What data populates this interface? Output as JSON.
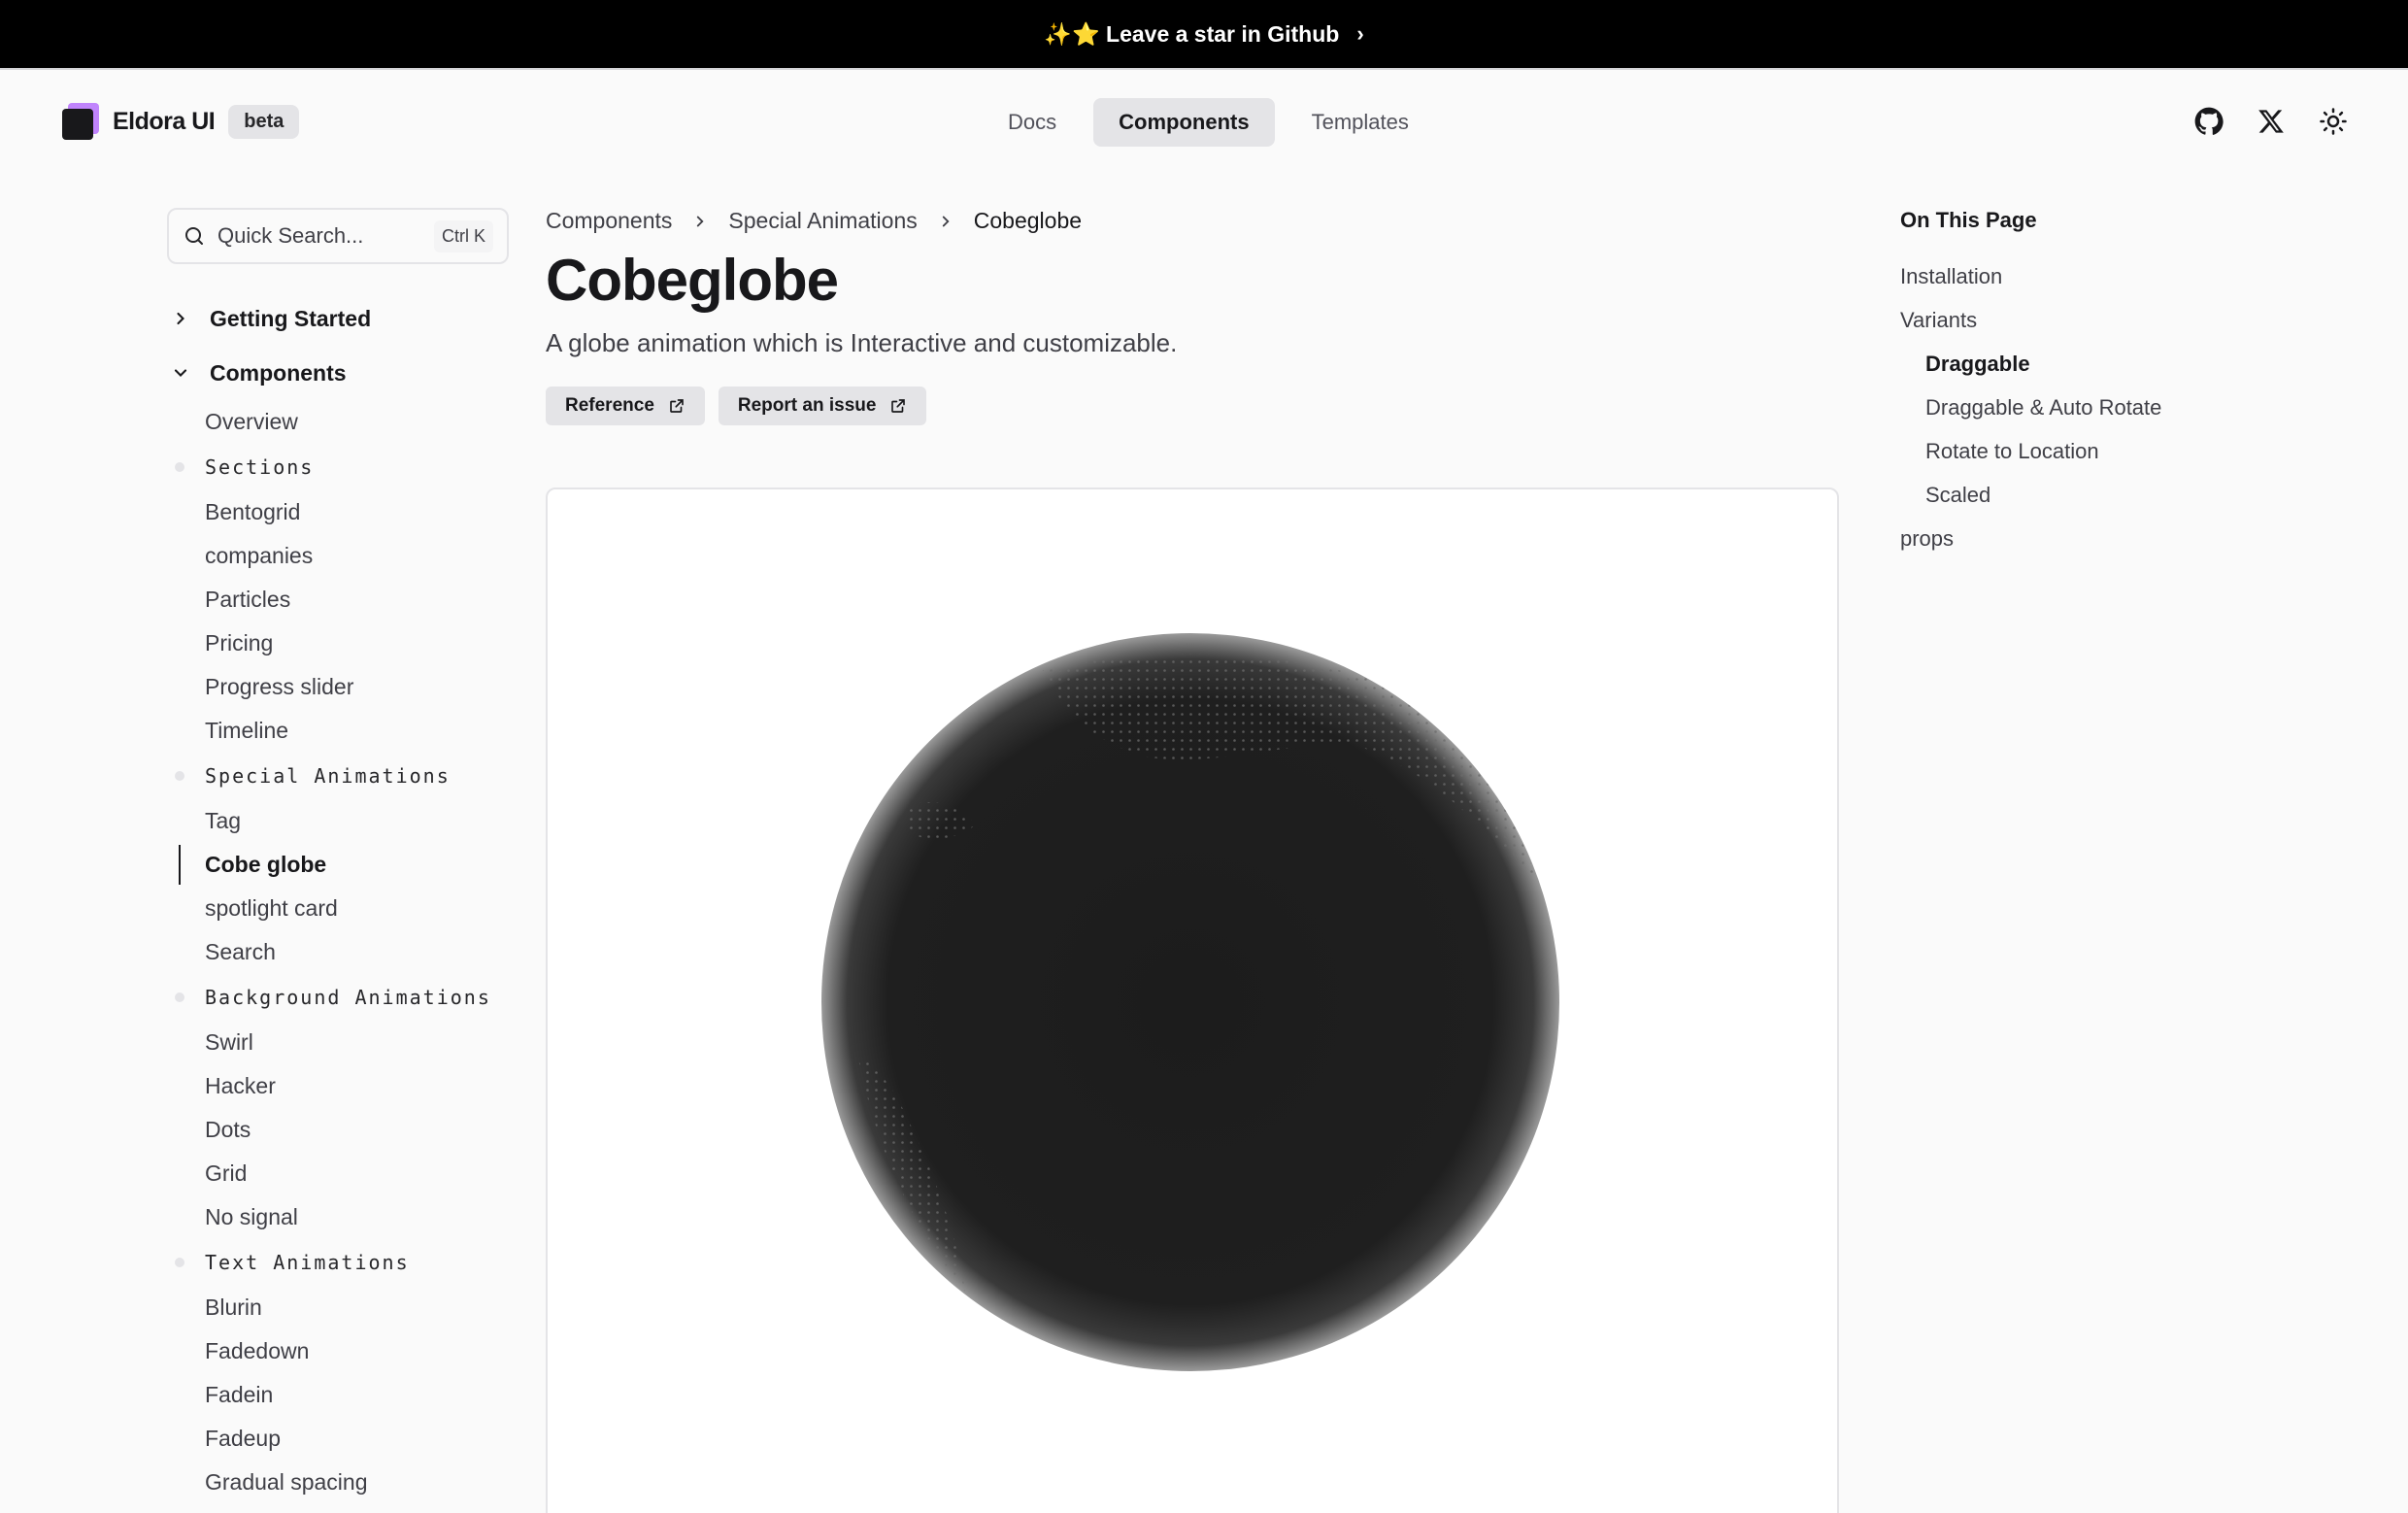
{
  "banner": {
    "text": "✨⭐ Leave a star in Github",
    "chevron": "›"
  },
  "header": {
    "brand": "Eldora UI",
    "badge": "beta",
    "nav": [
      {
        "label": "Docs",
        "active": false
      },
      {
        "label": "Components",
        "active": true
      },
      {
        "label": "Templates",
        "active": false
      }
    ],
    "icons": [
      "github-icon",
      "x-icon",
      "sun-icon"
    ]
  },
  "search": {
    "placeholder": "Quick Search...",
    "shortcut": "Ctrl K"
  },
  "sidebar": {
    "getting_started": "Getting Started",
    "components": "Components",
    "overview": "Overview",
    "sections": [
      {
        "title": "Sections",
        "items": [
          "Bentogrid",
          "companies",
          "Particles",
          "Pricing",
          "Progress slider",
          "Timeline"
        ]
      },
      {
        "title": "Special Animations",
        "items": [
          "Tag",
          "Cobe globe",
          "spotlight card",
          "Search"
        ]
      },
      {
        "title": "Background Animations",
        "items": [
          "Swirl",
          "Hacker",
          "Dots",
          "Grid",
          "No signal"
        ]
      },
      {
        "title": "Text Animations",
        "items": [
          "Blurin",
          "Fadedown",
          "Fadein",
          "Fadeup",
          "Gradual spacing"
        ]
      }
    ],
    "active_item": "Cobe globe"
  },
  "breadcrumb": [
    "Components",
    "Special Animations",
    "Cobeglobe"
  ],
  "page": {
    "title": "Cobeglobe",
    "subtitle": "A globe animation which is Interactive and customizable.",
    "buttons": [
      "Reference",
      "Report an issue"
    ]
  },
  "toc": {
    "title": "On This Page",
    "items": [
      {
        "label": "Installation",
        "sub": false,
        "active": false
      },
      {
        "label": "Variants",
        "sub": false,
        "active": false
      },
      {
        "label": "Draggable",
        "sub": true,
        "active": true
      },
      {
        "label": "Draggable & Auto Rotate",
        "sub": true,
        "active": false
      },
      {
        "label": "Rotate to Location",
        "sub": true,
        "active": false
      },
      {
        "label": "Scaled",
        "sub": true,
        "active": false
      },
      {
        "label": "props",
        "sub": false,
        "active": false
      }
    ]
  },
  "colors": {
    "banner_bg": "#000000",
    "accent": "#c084fc",
    "globe": "#1c1c1c"
  }
}
